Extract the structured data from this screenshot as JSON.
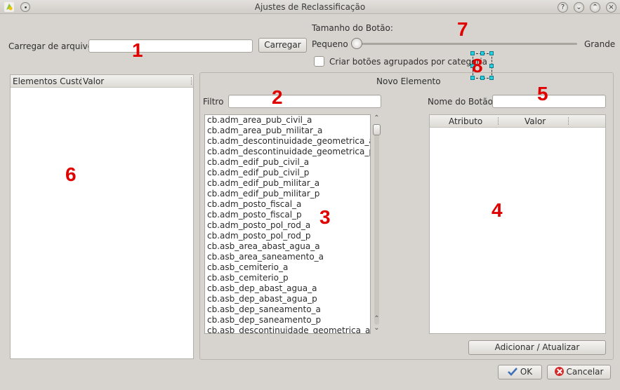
{
  "window": {
    "title": "Ajustes de Reclassificação",
    "controls": [
      "?",
      "⌄",
      "⌃",
      "×"
    ]
  },
  "load": {
    "label": "Carregar de arquivo",
    "input_value": "",
    "button": "Carregar"
  },
  "button_size": {
    "label": "Tamanho do Botão:",
    "min_label": "Pequeno",
    "max_label": "Grande",
    "value": 0
  },
  "group_by_category": {
    "label": "Criar botões agrupados por categoria",
    "checked": false
  },
  "custom_elements": {
    "columns": [
      "Elementos Custo",
      "Valor"
    ],
    "rows": []
  },
  "new_element": {
    "title": "Novo Elemento",
    "filter_label": "Filtro",
    "filter_value": "",
    "button_name_label": "Nome do Botão",
    "button_name_value": "",
    "classes": [
      "cb.adm_area_pub_civil_a",
      "cb.adm_area_pub_militar_a",
      "cb.adm_descontinuidade_geometrica_a",
      "cb.adm_descontinuidade_geometrica_p",
      "cb.adm_edif_pub_civil_a",
      "cb.adm_edif_pub_civil_p",
      "cb.adm_edif_pub_militar_a",
      "cb.adm_edif_pub_militar_p",
      "cb.adm_posto_fiscal_a",
      "cb.adm_posto_fiscal_p",
      "cb.adm_posto_pol_rod_a",
      "cb.adm_posto_pol_rod_p",
      "cb.asb_area_abast_agua_a",
      "cb.asb_area_saneamento_a",
      "cb.asb_cemiterio_a",
      "cb.asb_cemiterio_p",
      "cb.asb_dep_abast_agua_a",
      "cb.asb_dep_abast_agua_p",
      "cb.asb_dep_saneamento_a",
      "cb.asb_dep_saneamento_p",
      "cb.asb_descontinuidade_geometrica_a"
    ],
    "attributes_table": {
      "columns": [
        "Atributo",
        "Valor"
      ],
      "rows": []
    },
    "add_update_button": "Adicionar / Atualizar"
  },
  "footer": {
    "ok": "OK",
    "cancel": "Cancelar"
  },
  "annotations": [
    "1",
    "2",
    "3",
    "4",
    "5",
    "6",
    "7",
    "8"
  ],
  "colors": {
    "annotation": "#e00000",
    "selection_handle": "#22d3e6"
  }
}
